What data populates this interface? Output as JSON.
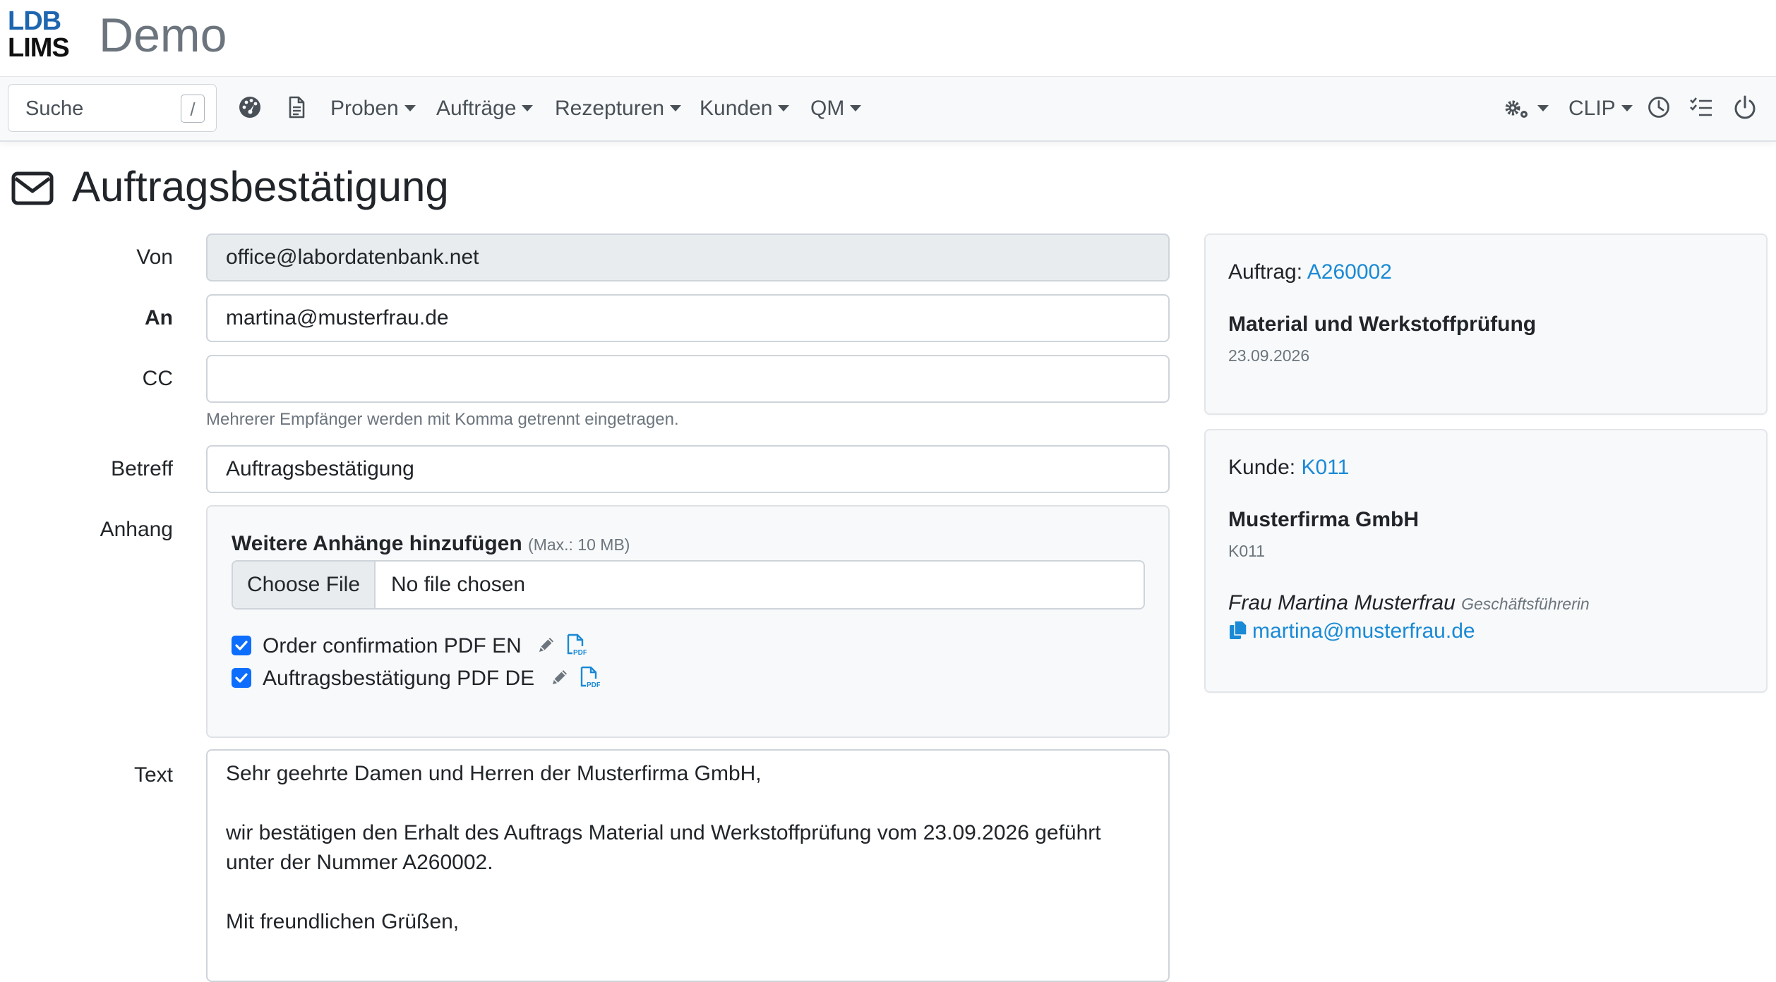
{
  "app": {
    "logo_line1": "LDB",
    "logo_line2": "LIMS",
    "title": "Demo"
  },
  "navbar": {
    "search_placeholder": "Suche",
    "search_shortcut": "/",
    "menus": [
      "Proben",
      "Aufträge",
      "Rezepturen",
      "Kunden",
      "QM"
    ],
    "user": "CLIP",
    "icons": [
      "dashboard-icon",
      "document-icon",
      "settings-icon",
      "clock-icon",
      "tasks-icon",
      "power-icon"
    ]
  },
  "page": {
    "title": "Auftragsbestätigung",
    "icon": "envelope-icon"
  },
  "form": {
    "von_label": "Von",
    "von_value": "office@labordatenbank.net",
    "an_label": "An",
    "an_value": "martina@musterfrau.de",
    "cc_label": "CC",
    "cc_value": "",
    "cc_help": "Mehrerer Empfänger werden mit Komma getrennt eingetragen.",
    "betreff_label": "Betreff",
    "betreff_value": "Auftragsbestätigung",
    "anhang_label": "Anhang",
    "attach_heading": "Weitere Anhänge hinzufügen",
    "attach_max": "(Max.: 10 MB)",
    "file_button": "Choose File",
    "file_status": "No file chosen",
    "attachments": [
      {
        "label": "Order confirmation PDF EN",
        "checked": true
      },
      {
        "label": "Auftragsbestätigung PDF DE",
        "checked": true
      }
    ],
    "text_label": "Text",
    "text_lines": [
      "Sehr geehrte Damen und Herren der Musterfirma GmbH,",
      "wir bestätigen den Erhalt des Auftrags Material und Werkstoffprüfung vom 23.09.2026 geführt unter der Nummer A260002.",
      "Mit freundlichen Grüßen,"
    ]
  },
  "order_card": {
    "label": "Auftrag:",
    "order_id": "A260002",
    "title": "Material und Werkstoffprüfung",
    "date": "23.09.2026"
  },
  "customer_card": {
    "label": "Kunde:",
    "customer_id": "K011",
    "name": "Musterfirma GmbH",
    "code": "K011",
    "contact_name": "Frau Martina Musterfrau",
    "contact_role": "Geschäftsführerin",
    "email": "martina@musterfrau.de"
  },
  "colors": {
    "brand_blue": "#1e66b0",
    "link": "#1a8ad6",
    "checkbox": "#0d6efd"
  }
}
